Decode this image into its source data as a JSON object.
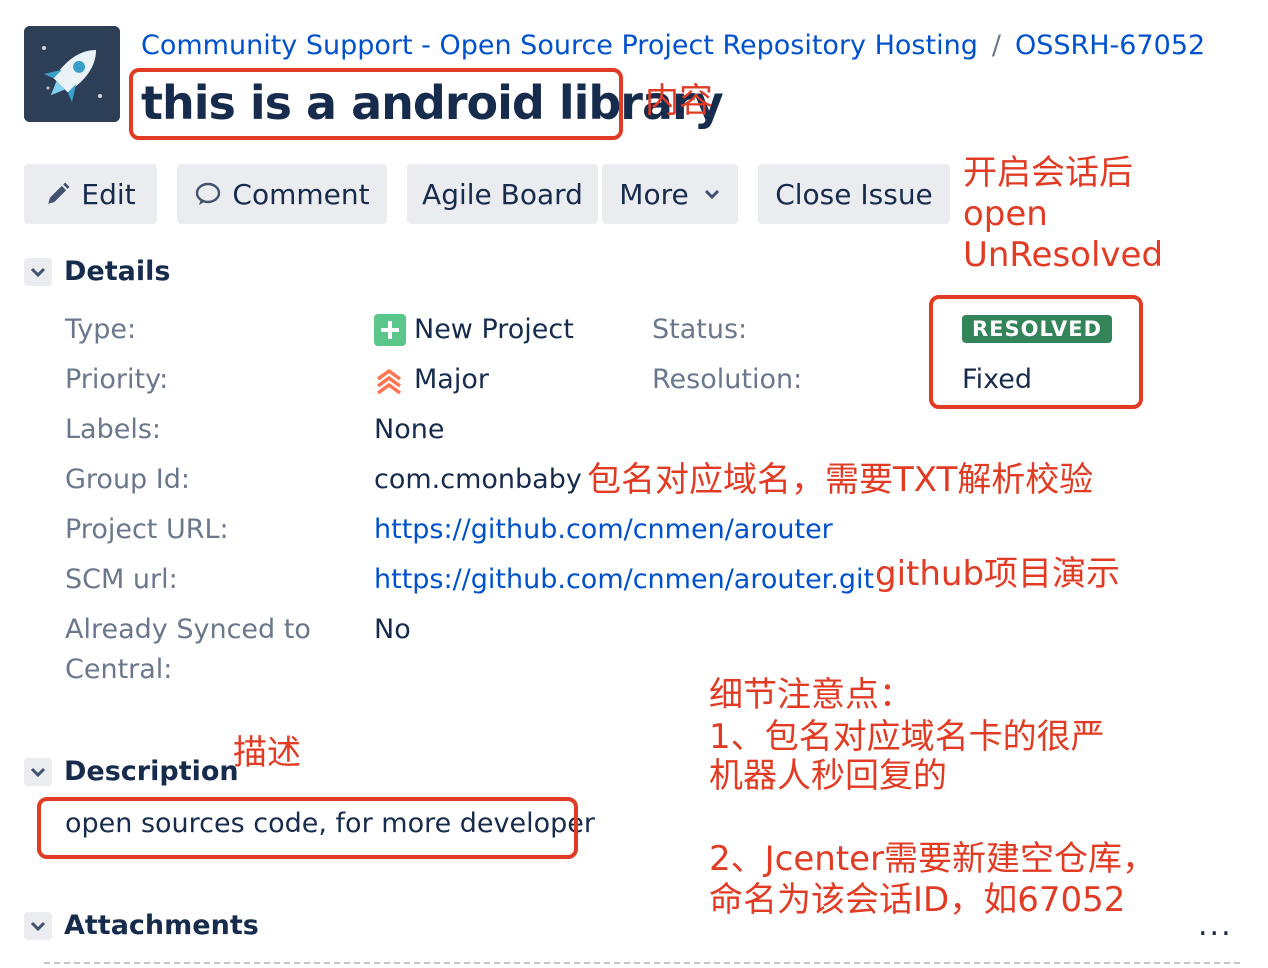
{
  "header": {
    "breadcrumb": {
      "project": "Community Support - Open Source Project Repository Hosting",
      "separator": "/",
      "issue_key": "OSSRH-67052"
    },
    "title": "this is a android library"
  },
  "toolbar": {
    "edit": "Edit",
    "comment": "Comment",
    "agile_board": "Agile Board",
    "more": "More",
    "close_issue": "Close Issue"
  },
  "details": {
    "heading": "Details",
    "type_label": "Type:",
    "type_value": "New Project",
    "priority_label": "Priority:",
    "priority_value": "Major",
    "labels_label": "Labels:",
    "labels_value": "None",
    "group_id_label": "Group Id:",
    "group_id_value": "com.cmonbaby",
    "project_url_label": "Project URL:",
    "project_url_value": "https://github.com/cnmen/arouter",
    "scm_url_label": "SCM url:",
    "scm_url_value": "https://github.com/cnmen/arouter.git",
    "synced_label_1": "Already Synced to",
    "synced_label_2": "Central:",
    "synced_value": "No",
    "status_label": "Status:",
    "status_value": "RESOLVED",
    "resolution_label": "Resolution:",
    "resolution_value": "Fixed"
  },
  "description": {
    "heading": "Description",
    "text": "open sources code, for more developer"
  },
  "attachments": {
    "heading": "Attachments",
    "more": "..."
  },
  "annotations": {
    "content": "内容",
    "session_1": "开启会话后",
    "session_2": "open",
    "session_3": "UnResolved",
    "group_note": "包名对应域名，需要TXT解析校验",
    "github_note": "github项目演示",
    "describe": "描述",
    "detail_1": "细节注意点：",
    "detail_2": "1、包名对应域名卡的很严",
    "detail_3": "机器人秒回复的",
    "detail_4": "2、Jcenter需要新建空仓库，",
    "detail_5": "命名为该会话ID，如67052"
  },
  "colors": {
    "link": "#0052cc",
    "annotation": "#e23b24",
    "resolved_lozenge": "#34845a",
    "new_project_icon": "#5ac68a",
    "major_priority": "#ff7452",
    "button_bg": "#ebecf0"
  },
  "icons": [
    "rocket-logo",
    "pencil-icon",
    "comment-icon",
    "chevron-down-icon",
    "new-project-icon",
    "priority-major-icon"
  ]
}
